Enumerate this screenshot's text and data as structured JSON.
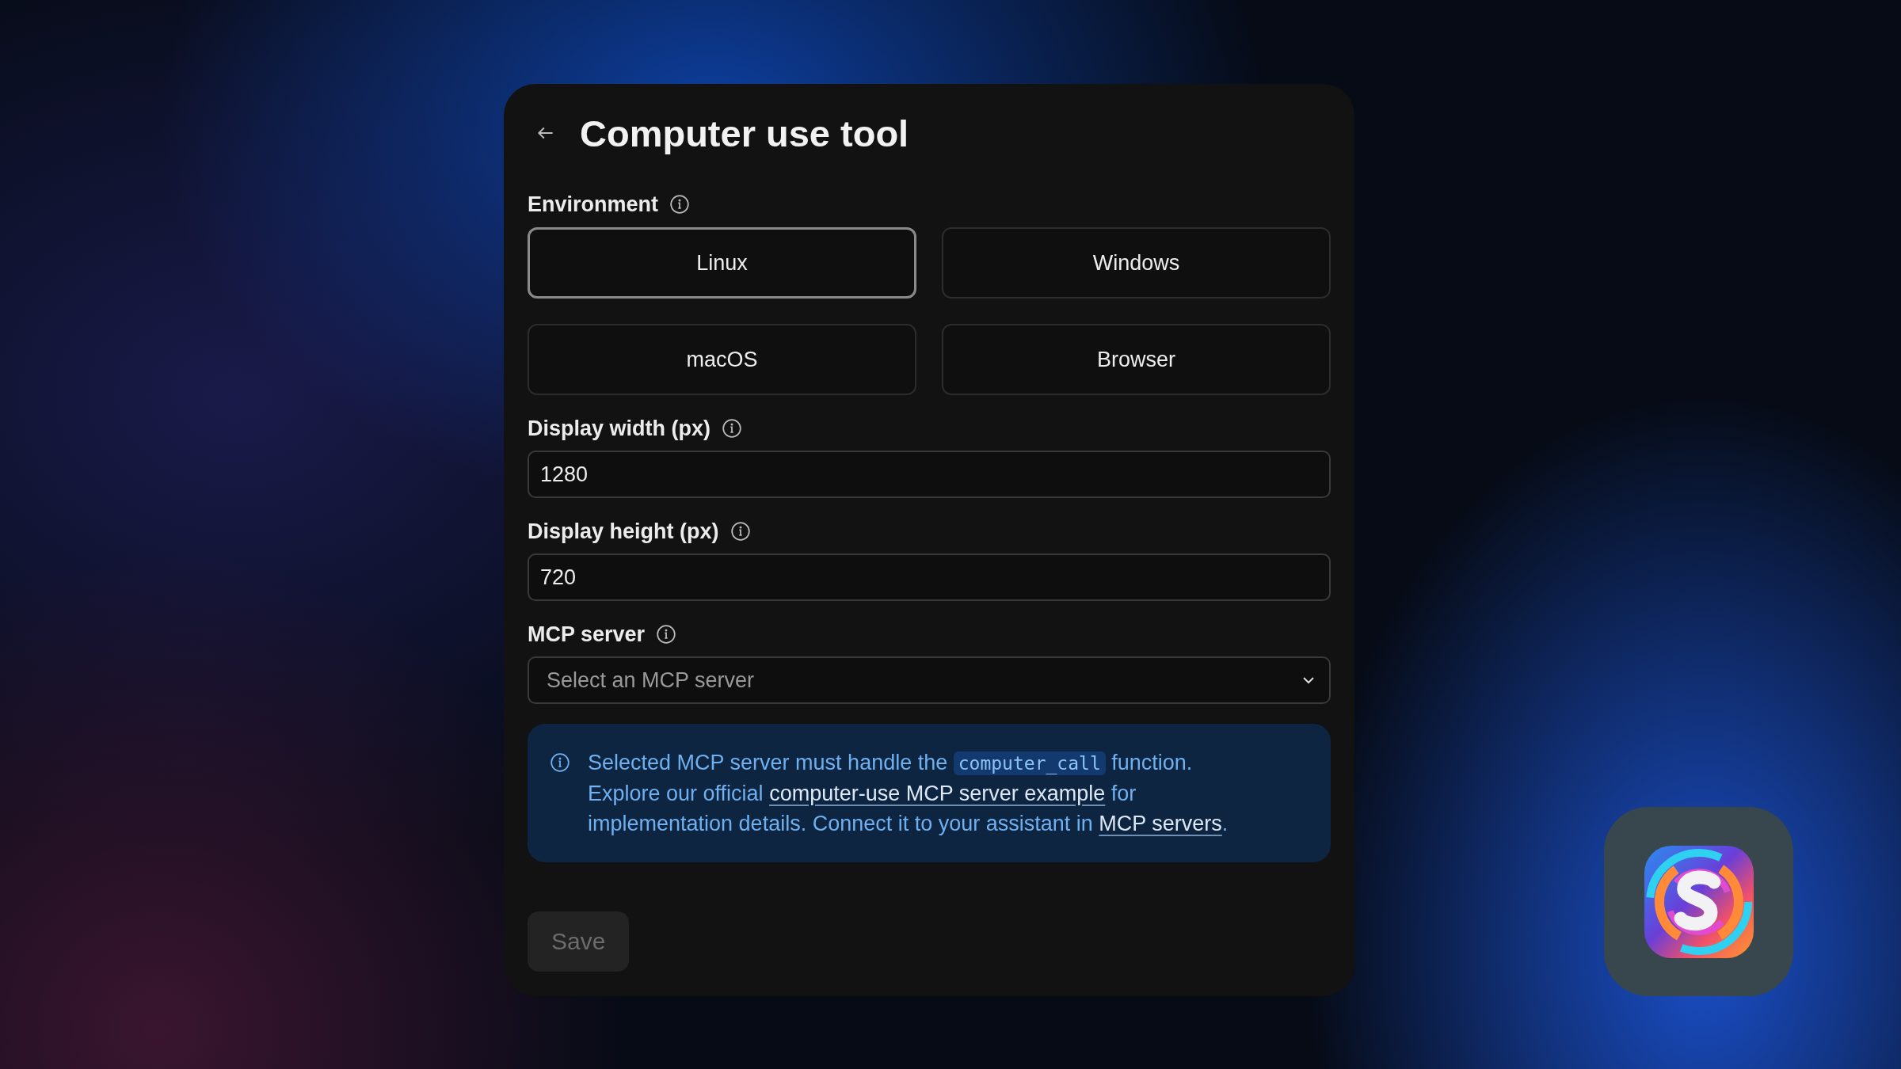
{
  "header": {
    "title": "Computer use tool"
  },
  "environment": {
    "label": "Environment",
    "options": [
      {
        "label": "Linux",
        "selected": true
      },
      {
        "label": "Windows",
        "selected": false
      },
      {
        "label": "macOS",
        "selected": false
      },
      {
        "label": "Browser",
        "selected": false
      }
    ]
  },
  "display_width": {
    "label": "Display width (px)",
    "value": "1280"
  },
  "display_height": {
    "label": "Display height (px)",
    "value": "720"
  },
  "mcp_server": {
    "label": "MCP server",
    "placeholder": "Select an MCP server"
  },
  "note": {
    "parts": [
      {
        "kind": "text",
        "text": "Selected MCP server must handle the "
      },
      {
        "kind": "code",
        "text": "computer_call"
      },
      {
        "kind": "text",
        "text": " function. Explore our official "
      },
      {
        "kind": "link",
        "text": "computer-use MCP server example"
      },
      {
        "kind": "text",
        "text": " for implementation details. Connect it to your assistant in "
      },
      {
        "kind": "link",
        "text": "MCP servers"
      },
      {
        "kind": "text",
        "text": "."
      }
    ]
  },
  "save": {
    "label": "Save",
    "disabled": true
  }
}
